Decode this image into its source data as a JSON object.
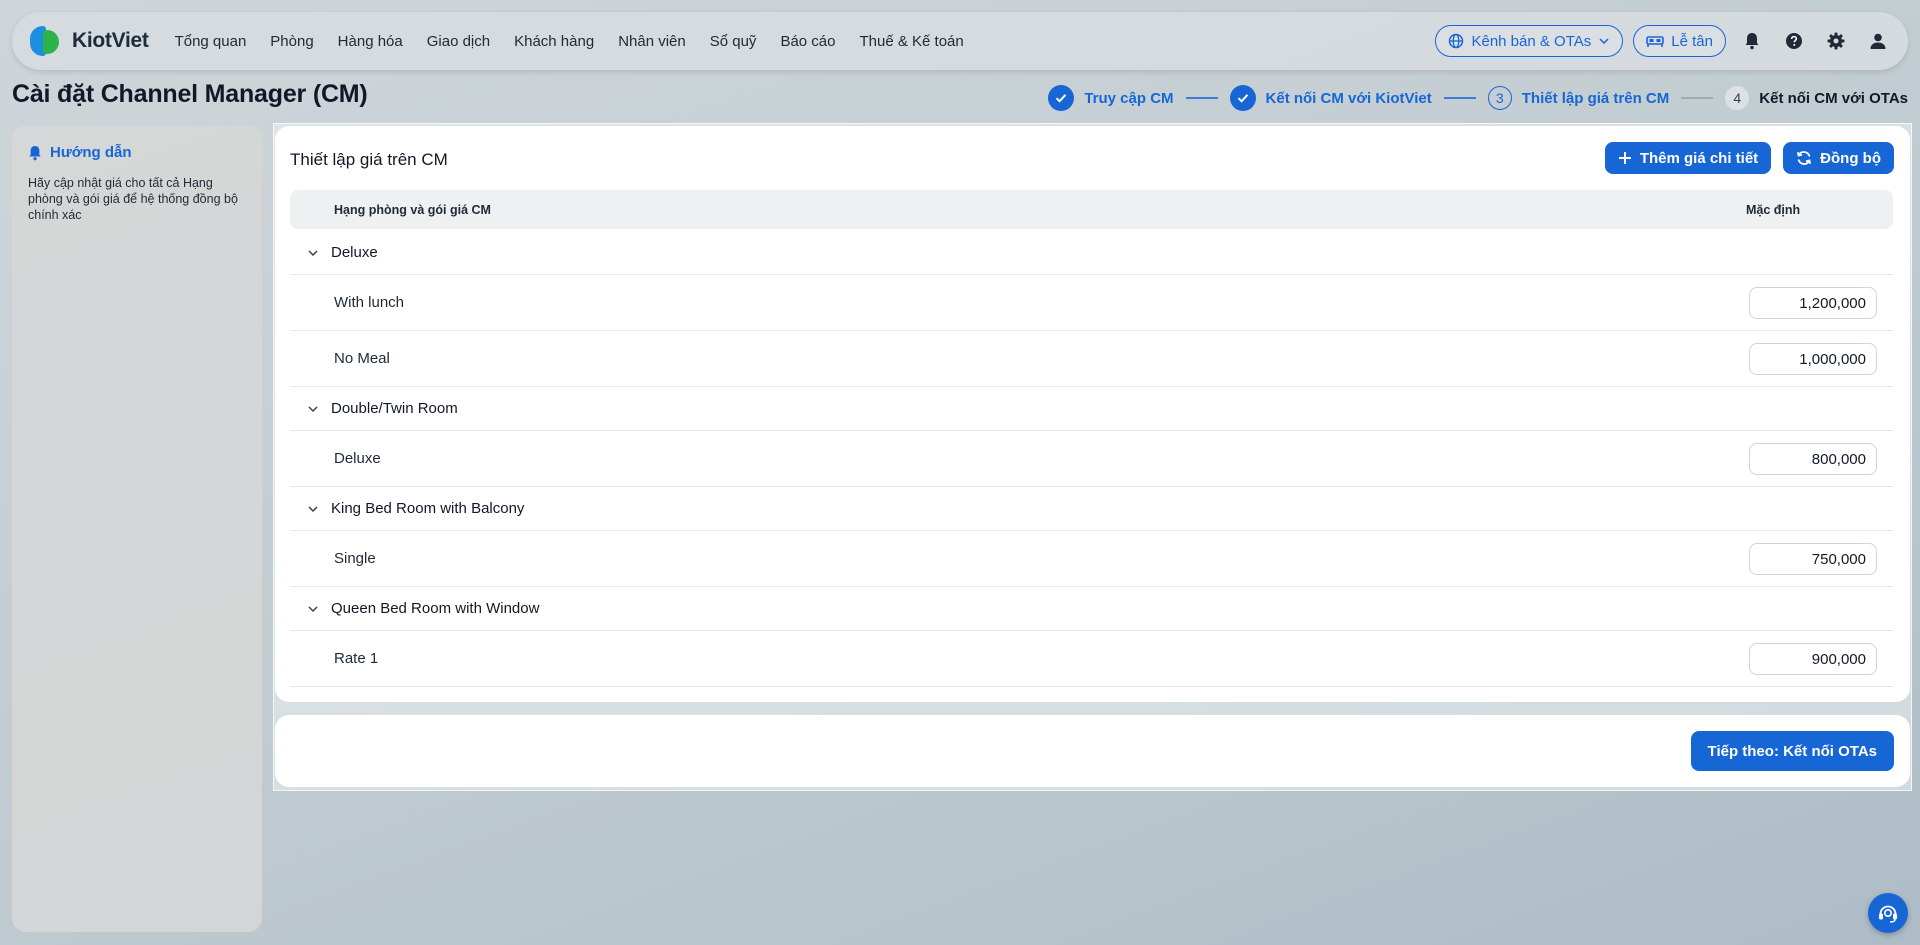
{
  "brand": {
    "name": "KiotViet",
    "colors": {
      "primary": "#1766d6",
      "logo_blue": "#1a8fe0",
      "logo_green": "#2db34a"
    }
  },
  "nav": {
    "items": [
      "Tổng quan",
      "Phòng",
      "Hàng hóa",
      "Giao dịch",
      "Khách hàng",
      "Nhân viên",
      "Sổ quỹ",
      "Báo cáo",
      "Thuế & Kế toán"
    ],
    "sales_channel_label": "Kênh bán & OTAs",
    "reception_label": "Lễ tân",
    "icons": [
      "globe-icon",
      "chevron-down-icon",
      "bed-icon",
      "bell-icon",
      "help-icon",
      "gear-icon",
      "user-icon"
    ]
  },
  "page": {
    "title": "Cài đặt Channel Manager (CM)"
  },
  "stepper": {
    "steps": [
      {
        "label": "Truy cập CM",
        "state": "done"
      },
      {
        "label": "Kết nối CM với KiotViet",
        "state": "done"
      },
      {
        "label": "Thiết lập giá trên CM",
        "number": "3",
        "state": "current"
      },
      {
        "label": "Kết nối CM với OTAs",
        "number": "4",
        "state": "upcoming"
      }
    ]
  },
  "guide": {
    "title": "Hướng dẫn",
    "text": "Hãy cập nhật giá cho tất cả Hạng phòng và gói giá để hệ thống đồng bộ chính xác"
  },
  "pricing": {
    "title": "Thiết lập giá trên CM",
    "add_detail_label": "Thêm giá chi tiết",
    "sync_label": "Đồng bộ",
    "columns": {
      "room_rate": "Hạng phòng và gói giá CM",
      "default": "Mặc định"
    },
    "groups": [
      {
        "name": "Deluxe",
        "rates": [
          {
            "name": "With lunch",
            "price": "1,200,000"
          },
          {
            "name": "No Meal",
            "price": "1,000,000"
          }
        ]
      },
      {
        "name": "Double/Twin Room",
        "rates": [
          {
            "name": "Deluxe",
            "price": "800,000"
          }
        ]
      },
      {
        "name": "King Bed Room with Balcony",
        "rates": [
          {
            "name": "Single",
            "price": "750,000"
          }
        ]
      },
      {
        "name": "Queen Bed Room with Window",
        "rates": [
          {
            "name": "Rate 1",
            "price": "900,000"
          }
        ]
      }
    ]
  },
  "footer": {
    "next_label": "Tiếp theo: Kết nối OTAs"
  }
}
